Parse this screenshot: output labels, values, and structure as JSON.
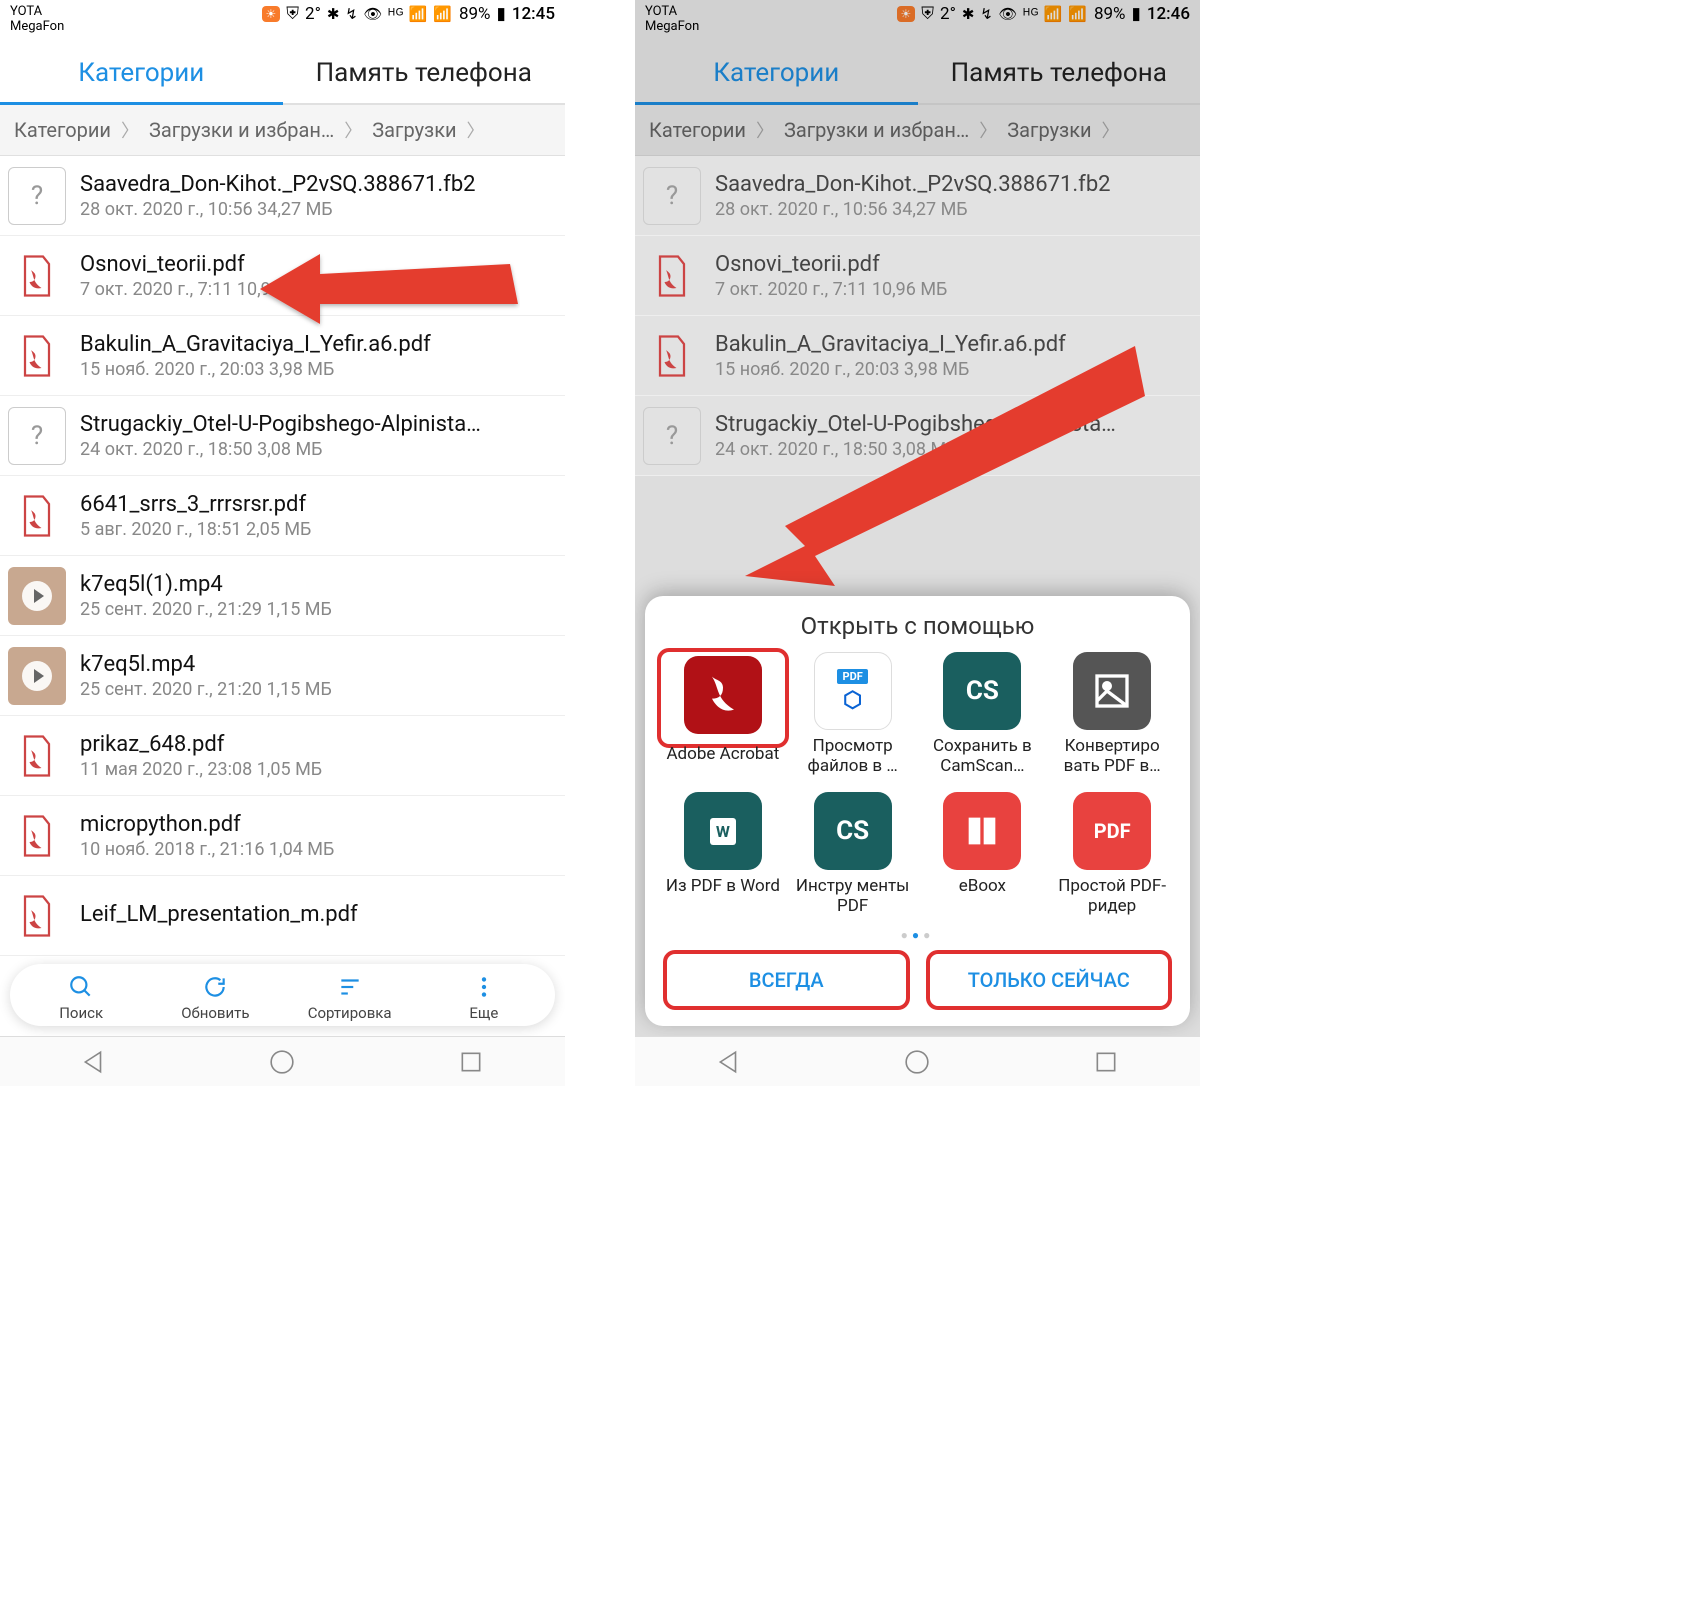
{
  "status": {
    "carrier1": "YOTA",
    "carrier2": "MegaFon",
    "temp": "2°",
    "battery_pct": "89%",
    "time_left": "12:45",
    "time_right": "12:46"
  },
  "tabs": {
    "categories": "Категории",
    "phone_storage": "Память телефона"
  },
  "breadcrumb": {
    "c1": "Категории",
    "c2": "Загрузки и избран…",
    "c3": "Загрузки"
  },
  "files": [
    {
      "name": "Saavedra_Don-Kihot._P2vSQ.388671.fb2",
      "meta": "28 окт. 2020 г., 10:56 34,27 МБ",
      "icon": "unknown"
    },
    {
      "name": "Osnovi_teorii.pdf",
      "meta": "7 окт. 2020 г., 7:11 10,96 МБ",
      "icon": "pdf"
    },
    {
      "name": "Bakulin_A_Gravitaciya_I_Yefir.a6.pdf",
      "meta": "15 нояб. 2020 г., 20:03 3,98 МБ",
      "icon": "pdf"
    },
    {
      "name": "Strugackiy_Otel-U-Pogibshego-Alpinista…",
      "meta": "24 окт. 2020 г., 18:50 3,08 МБ",
      "icon": "unknown"
    },
    {
      "name": "6641_srrs_3_rrrsrsr.pdf",
      "meta": "5 авг. 2020 г., 18:51 2,05 МБ",
      "icon": "pdf"
    },
    {
      "name": "k7eq5l(1).mp4",
      "meta": "25 сент. 2020 г., 21:29 1,15 МБ",
      "icon": "video"
    },
    {
      "name": "k7eq5l.mp4",
      "meta": "25 сент. 2020 г., 21:20 1,15 МБ",
      "icon": "video"
    },
    {
      "name": "prikaz_648.pdf",
      "meta": "11 мая 2020 г., 23:08 1,05 МБ",
      "icon": "pdf"
    },
    {
      "name": "micropython.pdf",
      "meta": "10 нояб. 2018 г., 21:16 1,04 МБ",
      "icon": "pdf"
    },
    {
      "name": "Leif_LM_presentation_m.pdf",
      "meta": "",
      "icon": "pdf"
    }
  ],
  "bottom": {
    "search": "Поиск",
    "refresh": "Обновить",
    "sort": "Сортировка",
    "more": "Еще"
  },
  "sheet": {
    "title": "Открыть с помощью",
    "always": "ВСЕГДА",
    "just_once": "ТОЛЬКО СЕЙЧАС",
    "apps": [
      {
        "label": "Adobe Acrobat"
      },
      {
        "label": "Просмотр файлов в …"
      },
      {
        "label": "Сохранить в CamScan…"
      },
      {
        "label": "Конвертиро вать PDF в…"
      },
      {
        "label": "Из PDF в Word"
      },
      {
        "label": "Инстру менты PDF"
      },
      {
        "label": "eBoox"
      },
      {
        "label": "Простой PDF-ридер"
      }
    ]
  }
}
